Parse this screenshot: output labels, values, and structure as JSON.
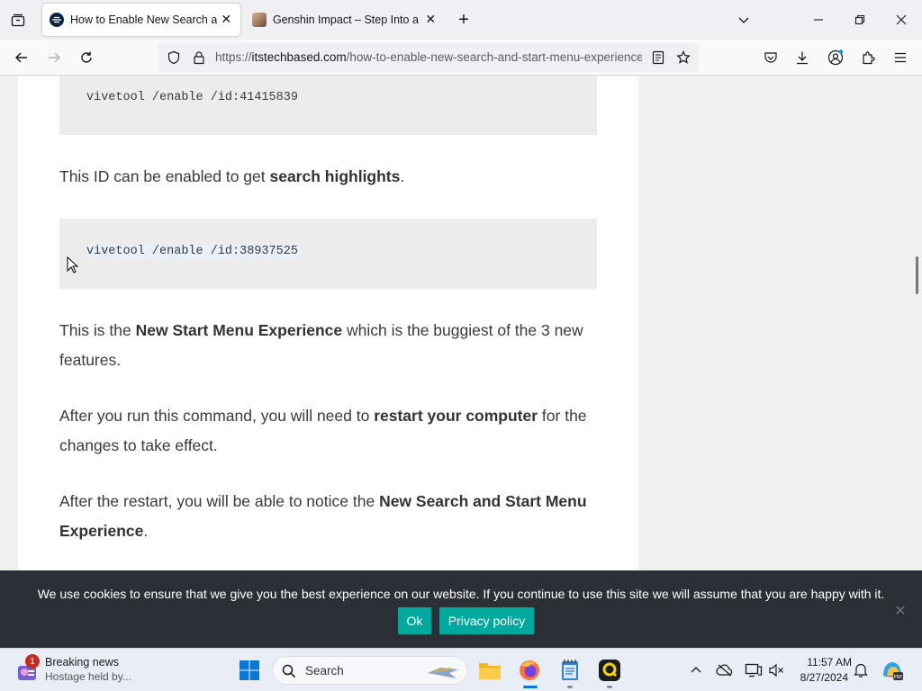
{
  "browser": {
    "tabs": [
      {
        "title": "How to Enable New Search and Start Menu Experience",
        "active": true,
        "favicon": "itstechbased-favicon"
      },
      {
        "title": "Genshin Impact – Step Into a Vast Magical World",
        "active": false,
        "favicon": "genshin-favicon"
      }
    ],
    "url": {
      "scheme": "https://",
      "domain": "itstechbased.com",
      "path": "/how-to-enable-new-search-and-start-menu-experience"
    }
  },
  "article": {
    "code1": "vivetool /enable /id:41415839",
    "para1": {
      "before": "This ID can be enabled to get ",
      "bold": "search highlights",
      "after": "."
    },
    "code2": "vivetool /enable /id:38937525",
    "para2": {
      "before": "This is the ",
      "bold": "New Start Menu Experience",
      "after": " which is the buggiest of the 3 new features."
    },
    "para3": {
      "before": "After you run this command, you will need to ",
      "bold": "restart your computer",
      "after": " for the changes to take effect."
    },
    "para4": {
      "before": "After the restart, you will be able to notice the ",
      "bold": "New Search and Start Menu Experience",
      "after": "."
    }
  },
  "cookie": {
    "text": "We use cookies to ensure that we give you the best experience on our website. If you continue to use this site we will assume that you are happy with it.",
    "ok_label": "Ok",
    "privacy_label": "Privacy policy",
    "accent": "#00a99d"
  },
  "taskbar": {
    "news_badge": "1",
    "news_title": "Breaking news",
    "news_subtitle": "Hostage held by...",
    "search_label": "Search",
    "time": "11:57 AM",
    "date": "8/27/2024"
  }
}
